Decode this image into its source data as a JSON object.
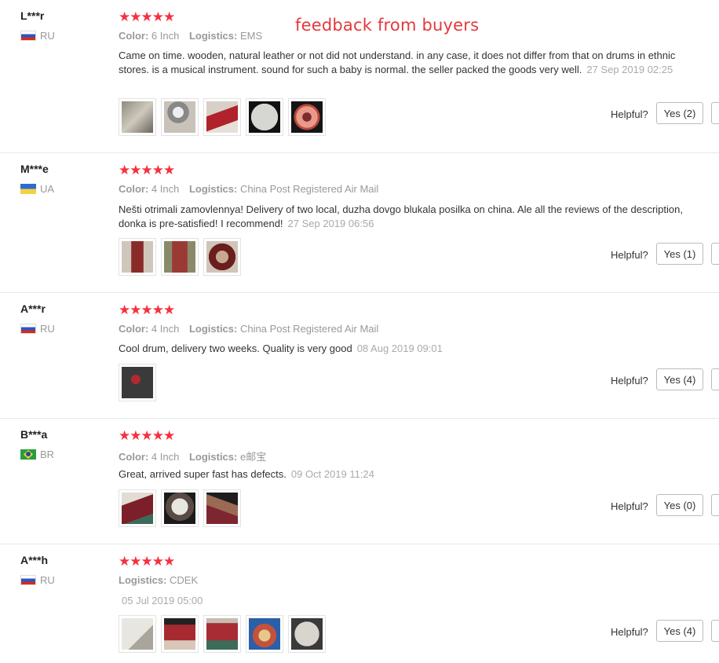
{
  "overlay_title": "feedback from buyers",
  "labels": {
    "color": "Color:",
    "logistics": "Logistics:",
    "helpful": "Helpful?",
    "stars": "★★★★★"
  },
  "reviews": [
    {
      "buyer": "L***r",
      "country": "RU",
      "color": "6 Inch",
      "logistics": "EMS",
      "text": "Came on time. wooden, natural leather or not did not understand. in any case, it does not differ from that on drums in ethnic stores. is a musical instrument. sound for such a baby is normal. the seller packed the goods very well.",
      "date": "27 Sep 2019 02:25",
      "photos": [
        "p-grey1",
        "p-grey2",
        "p-red1",
        "p-drum",
        "p-ring"
      ],
      "yes": "Yes (2)"
    },
    {
      "buyer": "M***e",
      "country": "UA",
      "color": "4 Inch",
      "logistics": "China Post Registered Air Mail",
      "text": "Nešti otrimali zamovlennya! Delivery of two local, duzha dovgo blukala posilka on china. Ale all the reviews of the description, donka is pre-satisfied! I recommend!",
      "date": "27 Sep 2019 06:56",
      "photos": [
        "p-tall",
        "p-tall2",
        "p-top"
      ],
      "yes": "Yes (1)"
    },
    {
      "buyer": "A***r",
      "country": "RU",
      "color": "4 Inch",
      "logistics": "China Post Registered Air Mail",
      "text": "Cool drum, delivery two weeks. Quality is very good",
      "date": "08 Aug 2019 09:01",
      "photos": [
        "p-dark"
      ],
      "yes": "Yes (4)"
    },
    {
      "buyer": "B***a",
      "country": "BR",
      "color": "4 Inch",
      "logistics": "e邮宝",
      "text": "Great, arrived super fast has defects.",
      "date": "09 Oct 2019 11:24",
      "photos": [
        "p-drum2",
        "p-drum3",
        "p-hand"
      ],
      "yes": "Yes (0)"
    },
    {
      "buyer": "A***h",
      "country": "RU",
      "color": "",
      "logistics": "CDEK",
      "text": "",
      "date": "05 Jul 2019 05:00",
      "photos": [
        "p-bag",
        "p-red2",
        "p-red3",
        "p-bowl",
        "p-white"
      ],
      "yes": "Yes (4)"
    }
  ]
}
